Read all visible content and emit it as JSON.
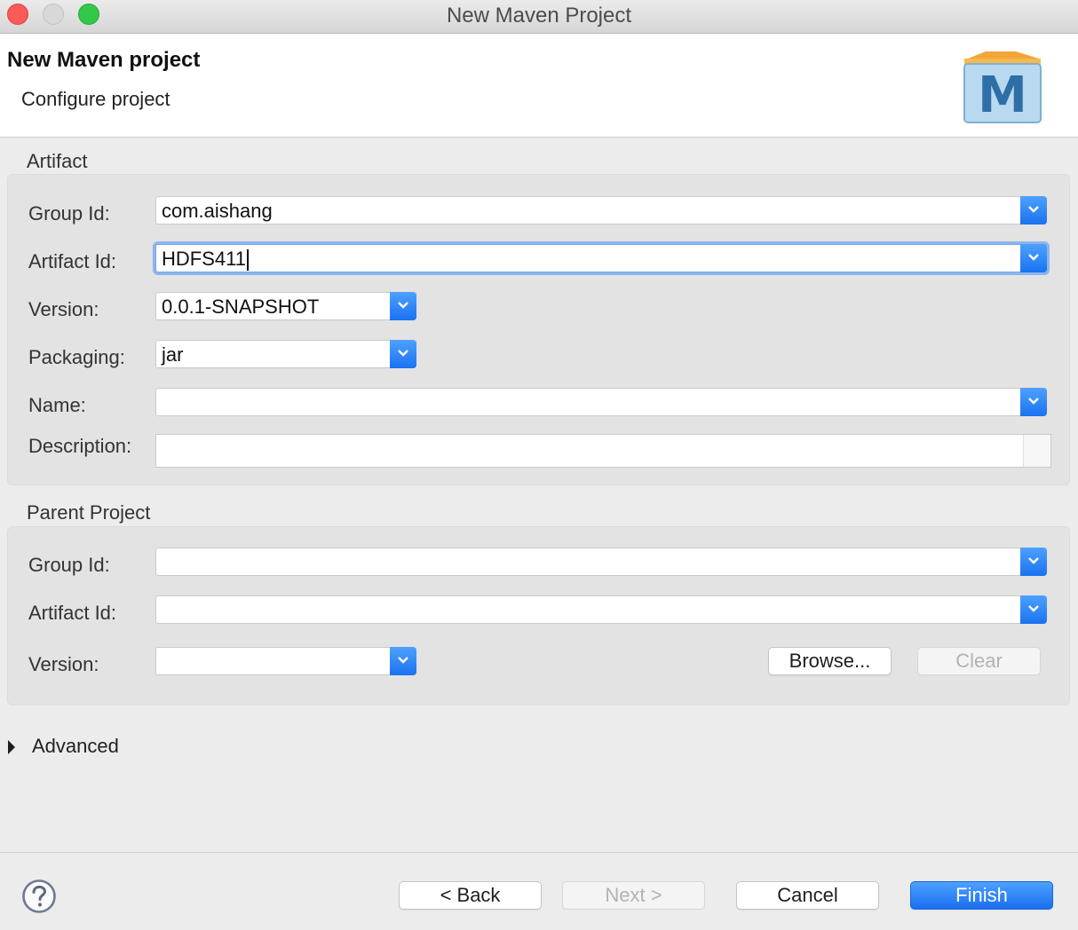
{
  "window": {
    "title": "New Maven Project"
  },
  "header": {
    "title": "New Maven project",
    "subtitle": "Configure project",
    "logo_letter": "M"
  },
  "artifact": {
    "section_label": "Artifact",
    "group_id": {
      "label": "Group Id:",
      "value": "com.aishang"
    },
    "artifact_id": {
      "label": "Artifact Id:",
      "value": "HDFS411"
    },
    "version": {
      "label": "Version:",
      "value": "0.0.1-SNAPSHOT"
    },
    "packaging": {
      "label": "Packaging:",
      "value": "jar"
    },
    "name": {
      "label": "Name:",
      "value": ""
    },
    "description": {
      "label": "Description:",
      "value": ""
    }
  },
  "parent": {
    "section_label": "Parent Project",
    "group_id": {
      "label": "Group Id:",
      "value": ""
    },
    "artifact_id": {
      "label": "Artifact Id:",
      "value": ""
    },
    "version": {
      "label": "Version:",
      "value": ""
    },
    "browse_label": "Browse...",
    "clear_label": "Clear"
  },
  "advanced": {
    "label": "Advanced"
  },
  "footer": {
    "back_label": "< Back",
    "next_label": "Next >",
    "cancel_label": "Cancel",
    "finish_label": "Finish"
  },
  "icons": {
    "help": "help-icon",
    "disclosure": "disclosure-triangle-icon",
    "dropdown": "chevron-down-icon"
  },
  "colors": {
    "accent": "#1a72f0",
    "close_light": "#fc5b57",
    "zoom_light": "#34c84a",
    "background": "#ececec"
  }
}
